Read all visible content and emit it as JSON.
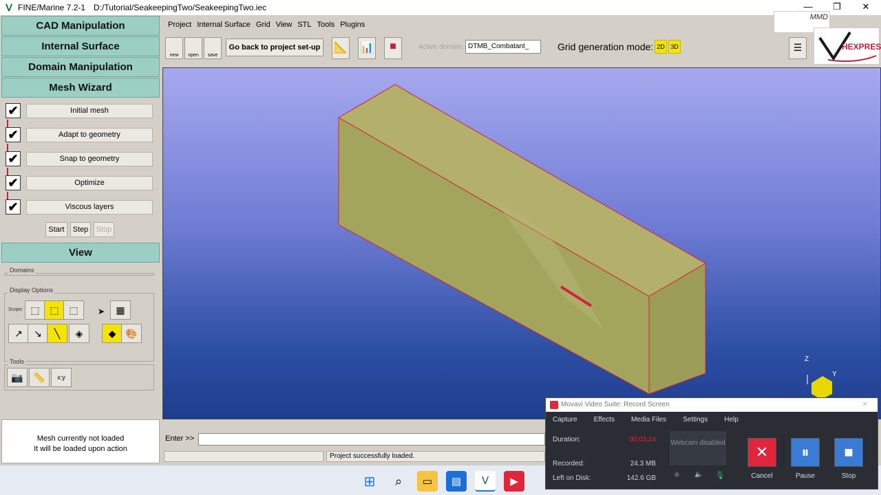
{
  "titlebar": {
    "app_title": "FINE/Marine 7.2-1",
    "path": "D:/Tutorial/SeakeepingTwo/SeakeepingTwo.iec",
    "minimize": "—",
    "restore": "❐",
    "close": "✕"
  },
  "left_panel": {
    "sections": [
      "CAD Manipulation",
      "Internal Surface",
      "Domain Manipulation",
      "Mesh Wizard"
    ],
    "wizard_steps": [
      {
        "label": "Initial mesh",
        "checked": true
      },
      {
        "label": "Adapt to geometry",
        "checked": true
      },
      {
        "label": "Snap to geometry",
        "checked": true
      },
      {
        "label": "Optimize",
        "checked": true
      },
      {
        "label": "Viscous layers",
        "checked": true
      }
    ],
    "start": "Start",
    "step": "Step",
    "stop": "Stop",
    "view_header": "View",
    "domains_label": "Domains",
    "display_options_label": "Display Options",
    "scope_label": "Scope:",
    "tools_label": "Tools",
    "mesh_status_line1": "Mesh currently not loaded",
    "mesh_status_line2": "It will be loaded upon action"
  },
  "menu": [
    "Project",
    "Internal Surface",
    "Grid",
    "View",
    "STL",
    "Tools",
    "Plugins"
  ],
  "toolbar": {
    "new": "new",
    "open": "open",
    "save": "save",
    "back_button": "Go back to project set-up",
    "active_domain_label": "Active domain:",
    "active_domain_value": "DTMB_Combatant_",
    "grid_mode_label": "Grid generation mode:",
    "mode_2d": "2D",
    "mode_3d": "3D"
  },
  "brand": {
    "name": "HEXPRESS",
    "mmd": "MMD"
  },
  "viewport": {
    "axis_z": "Z",
    "axis_y": "Y"
  },
  "bottom": {
    "enter_label": "Enter >>",
    "status_message": "Project successfully loaded."
  },
  "movavi": {
    "title": "Movavi Video Suite: Record Screen",
    "menu": [
      "Capture",
      "Effects",
      "Media Files",
      "Settings",
      "Help"
    ],
    "duration_label": "Duration:",
    "duration_value": "00:03:24",
    "recorded_label": "Recorded:",
    "recorded_value": "24.3 MB",
    "disk_label": "Left on Disk:",
    "disk_value": "142.6 GB",
    "webcam_text": "Webcam disabled",
    "cancel": "Cancel",
    "pause": "Pause",
    "stop": "Stop"
  },
  "colors": {
    "section_header": "#9ccfc4",
    "accent_yellow": "#f5e300",
    "box_face": "#a8aa5c",
    "box_edge": "#d8203a",
    "record_red": "#e0263c"
  }
}
